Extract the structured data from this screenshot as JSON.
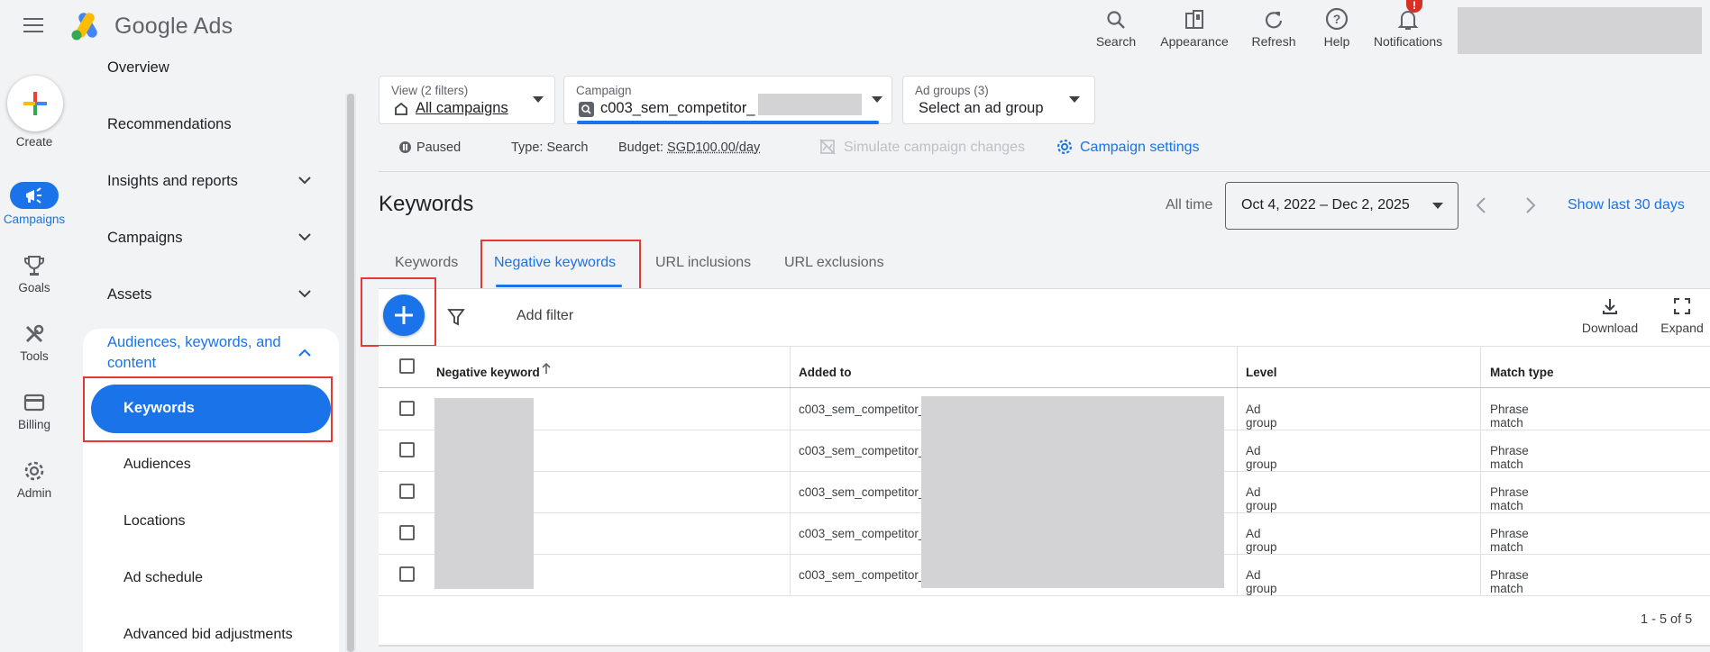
{
  "header": {
    "brand_google": "Google",
    "brand_ads": "Ads",
    "actions": [
      {
        "label": "Search",
        "icon": "search-icon"
      },
      {
        "label": "Appearance",
        "icon": "appearance-icon"
      },
      {
        "label": "Refresh",
        "icon": "refresh-icon"
      },
      {
        "label": "Help",
        "icon": "help-icon"
      },
      {
        "label": "Notifications",
        "icon": "bell-icon",
        "badge": "!"
      }
    ]
  },
  "rail": {
    "create": "Create",
    "items": [
      {
        "label": "Campaigns",
        "icon": "campaigns-icon",
        "active": true
      },
      {
        "label": "Goals",
        "icon": "trophy-icon"
      },
      {
        "label": "Tools",
        "icon": "tools-icon"
      },
      {
        "label": "Billing",
        "icon": "billing-icon"
      },
      {
        "label": "Admin",
        "icon": "gear-icon"
      }
    ]
  },
  "nav": {
    "overview": "Overview",
    "recommendations": "Recommendations",
    "insights": "Insights and reports",
    "campaigns": "Campaigns",
    "assets": "Assets",
    "audiences_section": "Audiences, keywords, and content",
    "sub": {
      "keywords": "Keywords",
      "audiences": "Audiences",
      "locations": "Locations",
      "ad_schedule": "Ad schedule",
      "advanced_bid": "Advanced bid adjustments"
    }
  },
  "filters": {
    "view_label": "View (2 filters)",
    "view_value": "All campaigns",
    "campaign_label": "Campaign",
    "campaign_value": "c003_sem_competitor_",
    "adgroups_label": "Ad groups (3)",
    "adgroups_value": "Select an ad group"
  },
  "status": {
    "paused": "Paused",
    "type_label": "Type:",
    "type_value": "Search",
    "budget_label": "Budget:",
    "budget_value": "SGD100.00/day",
    "simulate": "Simulate campaign changes",
    "settings": "Campaign settings"
  },
  "page": {
    "title": "Keywords",
    "all_time": "All time",
    "date_range": "Oct 4, 2022 – Dec 2, 2025",
    "show_last": "Show last 30 days"
  },
  "tabs": [
    "Keywords",
    "Negative keywords",
    "URL inclusions",
    "URL exclusions"
  ],
  "toolbar": {
    "add_filter": "Add filter",
    "download": "Download",
    "expand": "Expand"
  },
  "table": {
    "columns": [
      "Negative keyword",
      "Added to",
      "Level",
      "Match type"
    ],
    "rows": [
      {
        "added_to": "c003_sem_competitor_",
        "level": "Ad group",
        "match": "Phrase match"
      },
      {
        "added_to": "c003_sem_competitor_",
        "level": "Ad group",
        "match": "Phrase match"
      },
      {
        "added_to": "c003_sem_competitor_",
        "level": "Ad group",
        "match": "Phrase match"
      },
      {
        "added_to": "c003_sem_competitor_",
        "level": "Ad group",
        "match": "Phrase match"
      },
      {
        "added_to": "c003_sem_competitor_",
        "level": "Ad group",
        "match": "Phrase match"
      }
    ],
    "pagination": "1 - 5 of 5"
  },
  "colors": {
    "accent": "#1a73e8",
    "highlight": "#e53935"
  }
}
